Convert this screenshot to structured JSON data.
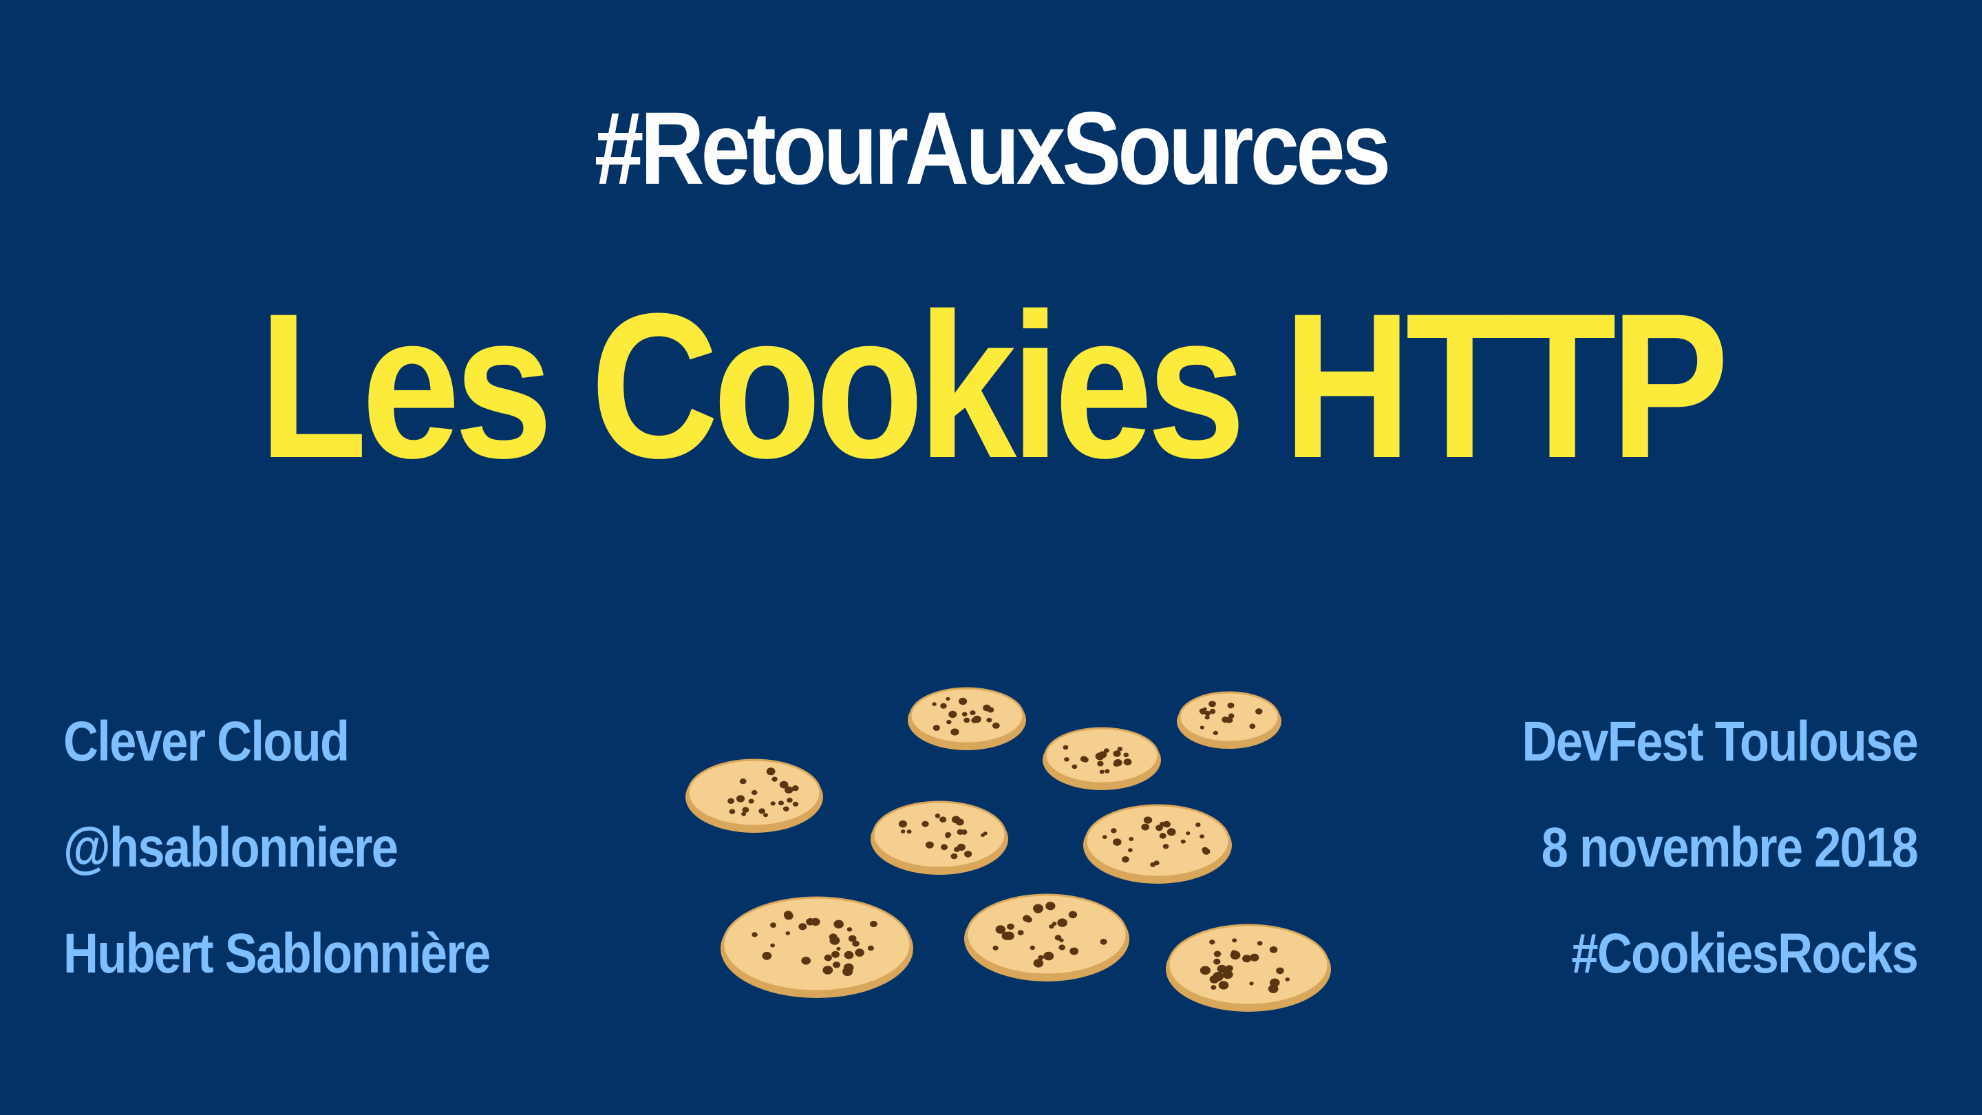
{
  "slide": {
    "top_hashtag": "#RetourAuxSources",
    "title": "Les Cookies HTTP",
    "left_info": [
      "Clever Cloud",
      "@hsablonniere",
      "Hubert Sablonnière"
    ],
    "right_info": [
      "DevFest Toulouse",
      "8 novembre 2018",
      "#CookiesRocks"
    ]
  },
  "colors": {
    "background": "#023266",
    "hashtag": "#ffffff",
    "title": "#fdeb3b",
    "info": "#7fbfff",
    "cookie_fill": "#f5cf8f",
    "cookie_edge": "#d9a75b",
    "chocolate_chip": "#5a3512"
  },
  "illustration": {
    "icon": "cookie-pile-icon",
    "cookie_count": 10
  }
}
